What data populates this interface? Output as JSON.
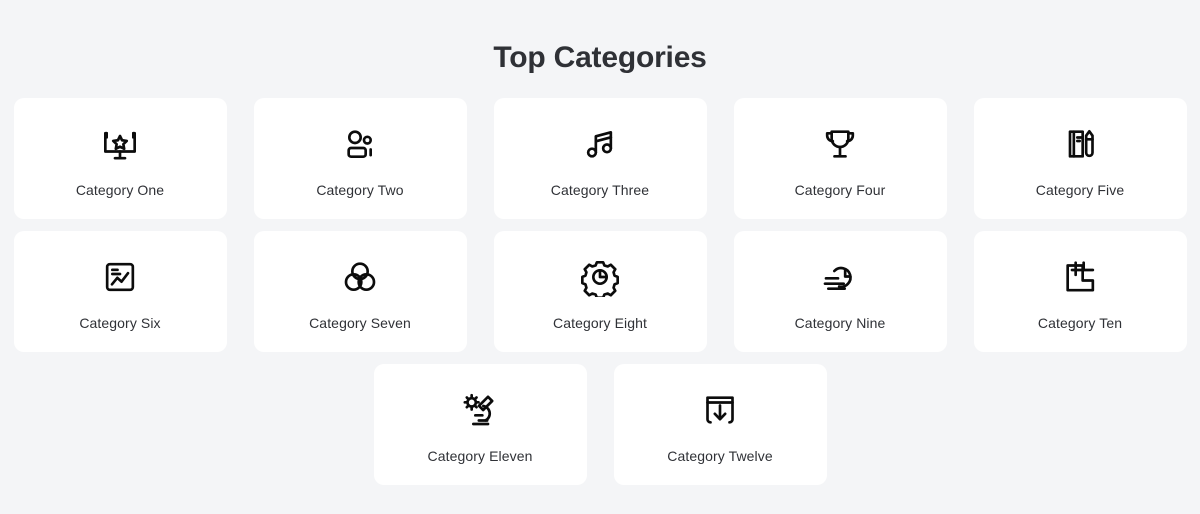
{
  "header": {
    "title": "Top Categories"
  },
  "theme": {
    "background": "#f4f5f7",
    "card_background": "#ffffff",
    "text_color": "#2f3136",
    "icon_color": "#0c0c0c"
  },
  "grid": {
    "cards": [
      {
        "label": "Category One",
        "icon": "monitor-star-icon"
      },
      {
        "label": "Category Two",
        "icon": "users-group-icon"
      },
      {
        "label": "Category Three",
        "icon": "music-note-icon"
      },
      {
        "label": "Category Four",
        "icon": "trophy-icon"
      },
      {
        "label": "Category Five",
        "icon": "notebook-pen-icon"
      },
      {
        "label": "Category Six",
        "icon": "chart-line-box-icon"
      },
      {
        "label": "Category Seven",
        "icon": "venn-circles-icon"
      },
      {
        "label": "Category Eight",
        "icon": "gear-pie-chart-icon"
      },
      {
        "label": "Category Nine",
        "icon": "clock-speed-icon"
      },
      {
        "label": "Category Ten",
        "icon": "layout-blocks-icon"
      },
      {
        "label": "Category Eleven",
        "icon": "microscope-germ-icon"
      },
      {
        "label": "Category Twelve",
        "icon": "download-box-icon"
      }
    ]
  }
}
